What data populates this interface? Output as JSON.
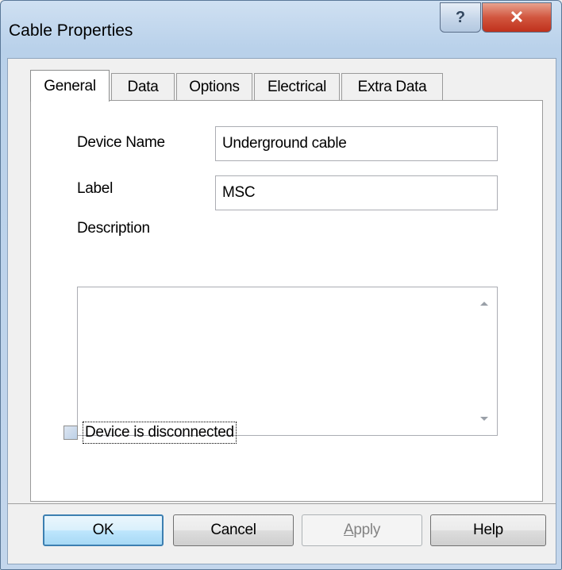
{
  "window": {
    "title": "Cable Properties"
  },
  "titlebar": {
    "help_glyph": "?",
    "close_glyph": "✕"
  },
  "tabs": [
    {
      "label": "General",
      "active": true
    },
    {
      "label": "Data",
      "active": false
    },
    {
      "label": "Options",
      "active": false
    },
    {
      "label": "Electrical",
      "active": false
    },
    {
      "label": "Extra Data",
      "active": false
    }
  ],
  "form": {
    "device_name_label": "Device Name",
    "device_name_value": "Underground cable",
    "label_label": "Label",
    "label_value": "MSC",
    "description_label": "Description",
    "description_value": "",
    "disconnected_label": "Device is disconnected",
    "disconnected_checked": false
  },
  "buttons": {
    "ok": "OK",
    "cancel": "Cancel",
    "apply_accel": "A",
    "apply_rest": "pply",
    "help": "Help"
  },
  "icons": {
    "help": "question-icon",
    "close": "close-icon",
    "scroll_up": "scroll-up-arrow-icon",
    "scroll_down": "scroll-down-arrow-icon"
  }
}
